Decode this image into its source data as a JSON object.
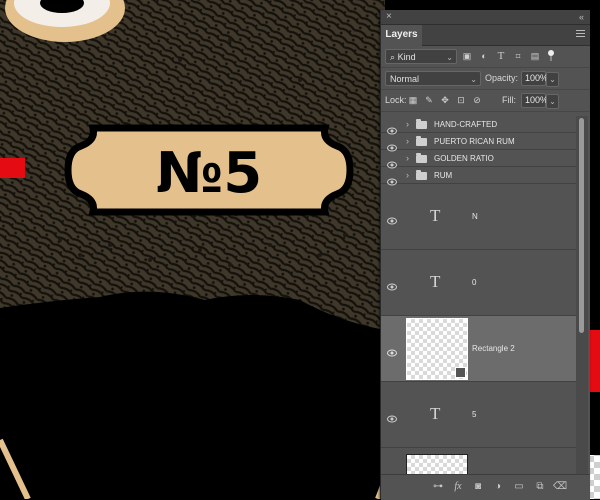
{
  "artwork": {
    "badge_text": "№5"
  },
  "panel": {
    "close_glyph": "×",
    "collapse_glyph": "«",
    "tab_label": "Layers",
    "menu_icon": "panel-menu-icon",
    "filter": {
      "kind_value": "Kind",
      "kind_prefix": "⌕",
      "icons": [
        "pixel-filter-icon",
        "adjustment-filter-icon",
        "type-filter-icon",
        "shape-filter-icon",
        "smart-object-filter-icon",
        "filter-toggle-icon"
      ]
    },
    "blend": {
      "mode_value": "Normal",
      "opacity_label": "Opacity:",
      "opacity_value": "100%"
    },
    "lock": {
      "label": "Lock:",
      "icons": [
        "lock-transparent-icon",
        "lock-image-icon",
        "lock-position-icon",
        "lock-artboard-icon",
        "lock-all-icon"
      ],
      "fill_label": "Fill:",
      "fill_value": "100%"
    },
    "layers": [
      {
        "type": "group",
        "name": "HAND-CRAFTED"
      },
      {
        "type": "group",
        "name": "PUERTO RICAN RUM"
      },
      {
        "type": "group",
        "name": "GOLDEN RATIO"
      },
      {
        "type": "group",
        "name": "RUM"
      },
      {
        "type": "text",
        "glyph": "T",
        "name": "N"
      },
      {
        "type": "text",
        "glyph": "T",
        "name": "0"
      },
      {
        "type": "shape",
        "name": "Rectangle 2",
        "selected": true
      },
      {
        "type": "text",
        "glyph": "T",
        "name": "5"
      },
      {
        "type": "shape",
        "name": ""
      }
    ],
    "footer_icons": [
      "link-layers-icon",
      "fx-icon",
      "add-mask-icon",
      "adjustment-layer-icon",
      "new-group-icon",
      "new-layer-icon",
      "delete-layer-icon"
    ],
    "fx_label": "fx"
  },
  "colors": {
    "tan": "#e3c08c",
    "dark_brown": "#3e372a",
    "red": "#e40b12",
    "panel_bg": "#535353",
    "selected_row": "#6c6c6c"
  }
}
